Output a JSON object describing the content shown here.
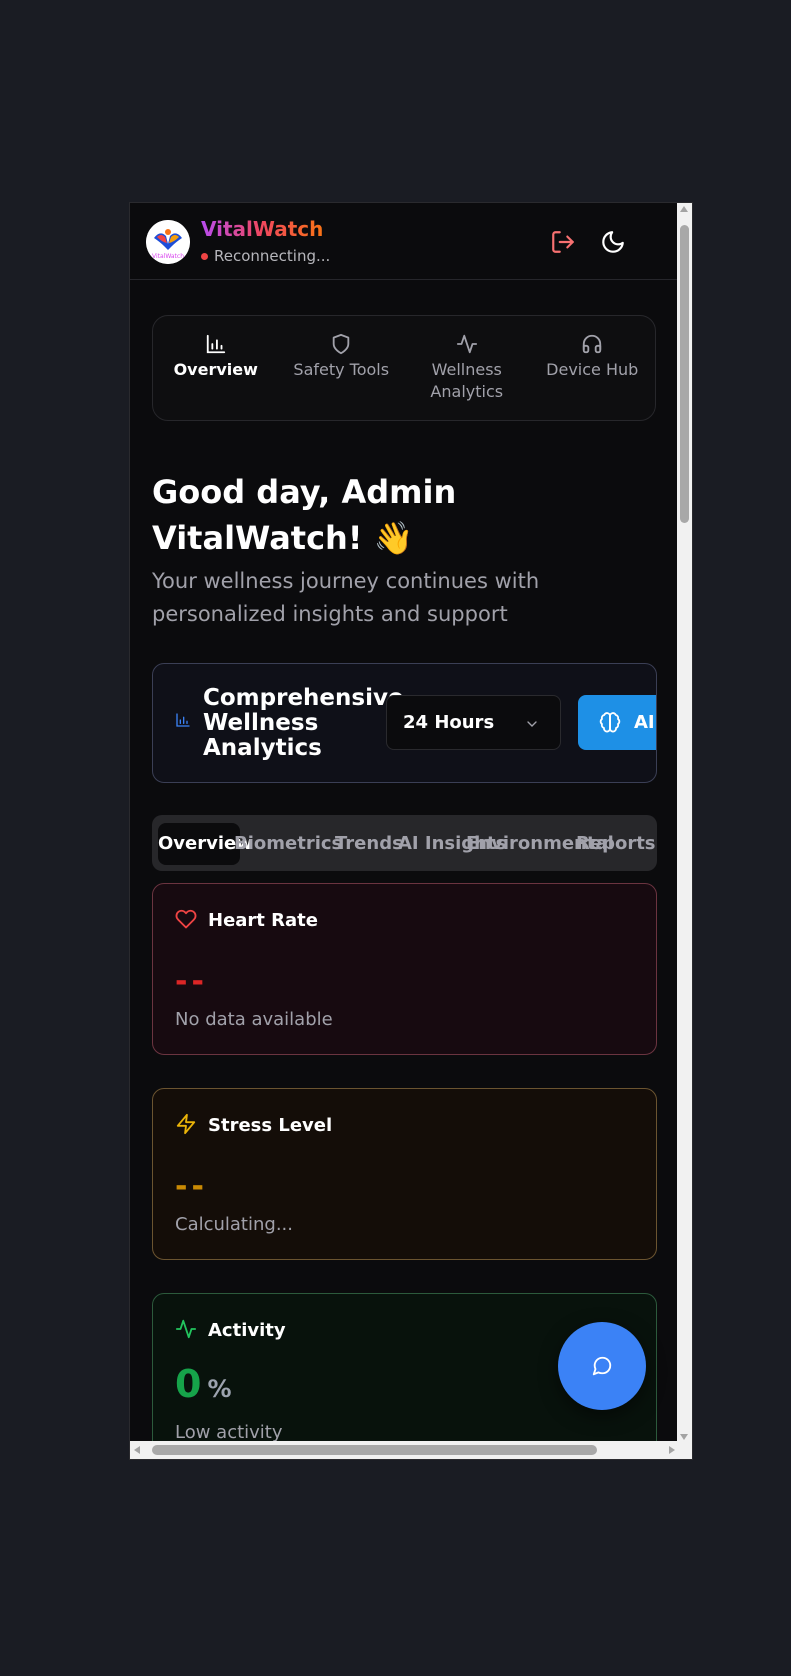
{
  "header": {
    "brand": "VitalWatch",
    "status": "Reconnecting...",
    "logo_text": "VitalWatch"
  },
  "nav": [
    {
      "label": "Overview",
      "icon": "bar-chart-icon"
    },
    {
      "label": "Safety Tools",
      "icon": "shield-icon"
    },
    {
      "label": "Wellness Analytics",
      "icon": "activity-icon"
    },
    {
      "label": "Device Hub",
      "icon": "headphones-icon"
    }
  ],
  "greeting": "Good day, Admin VitalWatch! 👋",
  "subtitle": "Your wellness journey continues with personalized insights and support",
  "analytics": {
    "title": "Comprehensive Wellness Analytics",
    "range": "24 Hours",
    "ai_button": "AI A"
  },
  "tabs": [
    "Overview",
    "Biometrics",
    "Trends",
    "AI Insights",
    "Environmental",
    "Reports"
  ],
  "cards": [
    {
      "title": "Heart Rate",
      "value": "--",
      "note": "No data available",
      "color": "#ef4444"
    },
    {
      "title": "Stress Level",
      "value": "--",
      "note": "Calculating...",
      "color": "#eab308"
    },
    {
      "title": "Activity",
      "value": "0",
      "unit": "%",
      "note": "Low activity",
      "color": "#22c55e"
    }
  ],
  "colors": {
    "accent": "#3b82f6",
    "ai_button": "#1e90e6",
    "status_dot": "#ef4444"
  }
}
